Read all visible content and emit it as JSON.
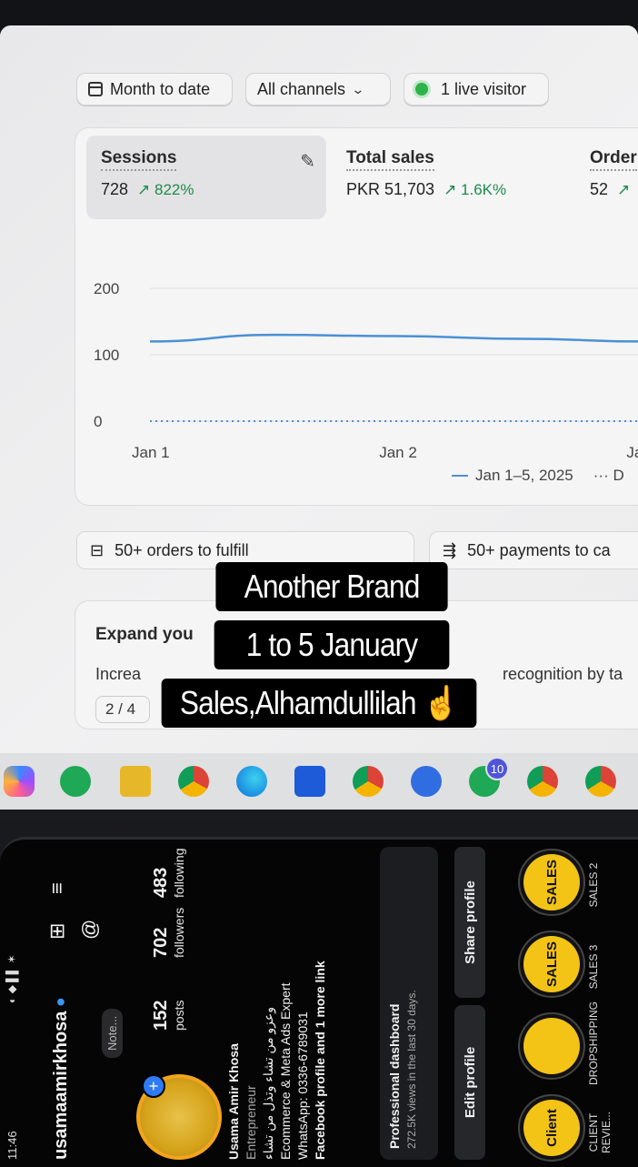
{
  "dashboard": {
    "filters": {
      "date_range": "Month to date",
      "channels": "All channels",
      "live_visitors": "1 live visitor"
    },
    "metrics": [
      {
        "label": "Sessions",
        "value": "728",
        "change": "↗ 822%"
      },
      {
        "label": "Total sales",
        "value": "PKR 51,703",
        "change": "↗ 1.6K%"
      },
      {
        "label": "Order",
        "value": "52",
        "change": "↗"
      }
    ],
    "chart_data": {
      "type": "line",
      "x": [
        "Jan 1",
        "Jan 2",
        "Jan"
      ],
      "y_ticks": [
        "200",
        "100",
        "0"
      ],
      "ylim": [
        0,
        200
      ],
      "series": [
        {
          "name": "Jan 1–5, 2025",
          "color": "#4a90d6",
          "x": [
            0,
            0.5,
            1,
            1.5,
            2.0
          ],
          "values": [
            120,
            130,
            128,
            124,
            120
          ]
        },
        {
          "color": "#4a90d6",
          "style": "dotted",
          "x": [
            0,
            2.0
          ],
          "values": [
            0,
            0
          ]
        }
      ],
      "legend": "Jan 1–5, 2025",
      "legend_more": "··· D"
    },
    "tasks": [
      {
        "label": "50+ orders to fulfill",
        "icon": "inbox-icon"
      },
      {
        "label": "50+ payments to ca",
        "icon": "payment-icon"
      }
    ],
    "promo": {
      "title": "Expand you",
      "body_left": "Increa",
      "body_right": "recognition by ta",
      "pager": "2 / 4"
    },
    "taskbar_badge": "10"
  },
  "caption": {
    "lines": [
      "Another Brand",
      "1 to 5 January",
      "Sales,Alhamdullilah ☝️"
    ]
  },
  "instagram": {
    "status_time": "11:46",
    "username": "usamaamirkhosa",
    "posts": {
      "count": "152",
      "label": "posts"
    },
    "followers": {
      "count": "702",
      "label": "followers"
    },
    "following": {
      "count": "483",
      "label": "following"
    },
    "note": "Note...",
    "name": "Usama Amir Khosa",
    "category": "Entrepreneur",
    "bio_urdu": "وعزو من تشاء وتذل من تشاء",
    "bio_line1": "Ecommerce & Meta Ads Expert",
    "bio_line2": "WhatsApp: 0336-6789031",
    "bio_line3": "Facebook profile and 1 more link",
    "dashboard_title": "Professional dashboard",
    "dashboard_sub": "272.5K views in the last 30 days.",
    "edit_profile": "Edit profile",
    "share_profile": "Share profile",
    "highlights": [
      {
        "inner": "Client",
        "label": "CLIENT REVIE..."
      },
      {
        "inner": "",
        "label": "DROPSHIPPING"
      },
      {
        "inner": "SALES",
        "label": "SALES 3"
      },
      {
        "inner": "SALES",
        "label": "SALES 2"
      }
    ]
  }
}
